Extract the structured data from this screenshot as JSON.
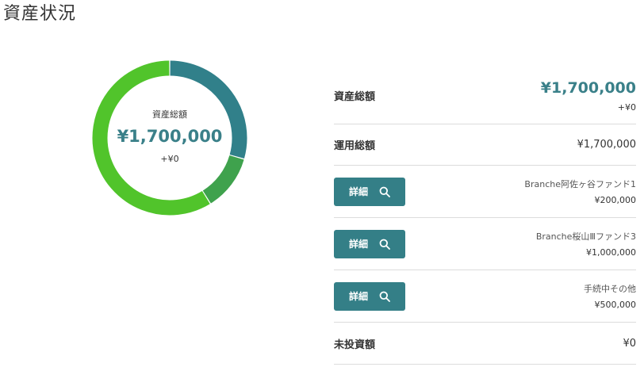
{
  "page": {
    "title": "資産状況"
  },
  "donut": {
    "label": "資産総額",
    "total": "¥1,700,000",
    "change": "+¥0",
    "segments": [
      {
        "value": 500000,
        "color": "#31808a"
      },
      {
        "value": 200000,
        "color": "#3fa24d"
      },
      {
        "value": 1000000,
        "color": "#51c42b"
      }
    ]
  },
  "summary": {
    "total": {
      "label": "資産総額",
      "value": "¥1,700,000",
      "change": "+¥0"
    },
    "operating": {
      "label": "運用総額",
      "value": "¥1,700,000"
    },
    "funds": [
      {
        "button_label": "詳細",
        "name": "Branche阿佐ヶ谷ファンド1",
        "amount": "¥200,000"
      },
      {
        "button_label": "詳細",
        "name": "Branche桜山Ⅲファンド3",
        "amount": "¥1,000,000"
      },
      {
        "button_label": "詳細",
        "name": "手続中その他",
        "amount": "¥500,000"
      }
    ],
    "uninvested": {
      "label": "未投資額",
      "value": "¥0"
    }
  },
  "icons": {
    "detail": "search-icon"
  },
  "colors": {
    "accent": "#347f87",
    "divider": "#dcdcdc"
  }
}
